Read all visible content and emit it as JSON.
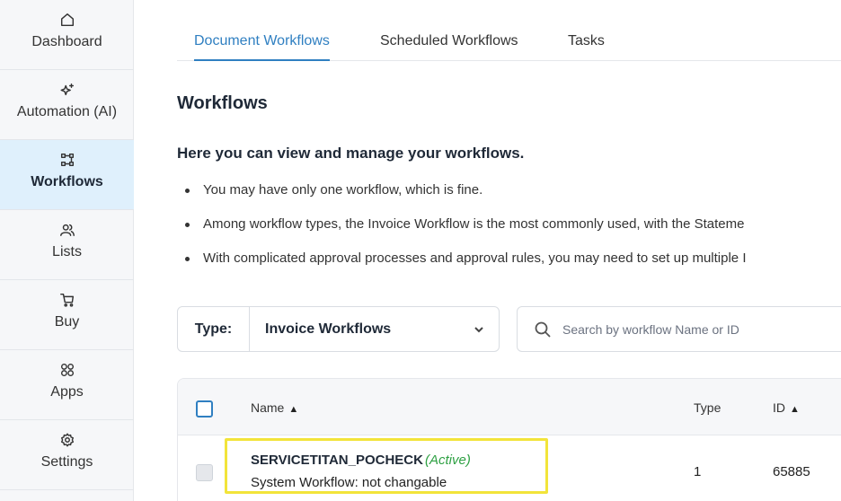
{
  "sidebar": {
    "items": [
      {
        "label": "Dashboard",
        "icon": "home-icon"
      },
      {
        "label": "Automation (AI)",
        "icon": "sparkle-icon"
      },
      {
        "label": "Workflows",
        "icon": "workflow-icon",
        "active": true
      },
      {
        "label": "Lists",
        "icon": "users-icon"
      },
      {
        "label": "Buy",
        "icon": "cart-icon"
      },
      {
        "label": "Apps",
        "icon": "apps-grid-icon"
      },
      {
        "label": "Settings",
        "icon": "gear-icon"
      }
    ]
  },
  "tabs": [
    {
      "label": "Document Workflows",
      "active": true
    },
    {
      "label": "Scheduled Workflows"
    },
    {
      "label": "Tasks"
    }
  ],
  "page": {
    "title": "Workflows",
    "intro": "Here you can view and manage your workflows.",
    "bullets": [
      "You may have only one workflow, which is fine.",
      "Among workflow types, the Invoice Workflow is the most commonly used, with the Stateme",
      "With complicated approval processes and approval rules, you may need to set up multiple I"
    ]
  },
  "filters": {
    "type_label": "Type:",
    "type_value": "Invoice Workflows",
    "search_placeholder": "Search by workflow Name or ID"
  },
  "table": {
    "columns": {
      "name": "Name",
      "type": "Type",
      "id": "ID"
    },
    "sort_glyph": "▲",
    "rows": [
      {
        "name": "SERVICETITAN_POCHECK",
        "status": "(Active)",
        "subtitle": "System Workflow: not changable",
        "type": "1",
        "id": "65885"
      }
    ]
  },
  "colors": {
    "accent": "#2f7fc1",
    "active_status": "#2ea043",
    "highlight": "#f2e43a",
    "active_sidebar_bg": "#dff0fc"
  }
}
